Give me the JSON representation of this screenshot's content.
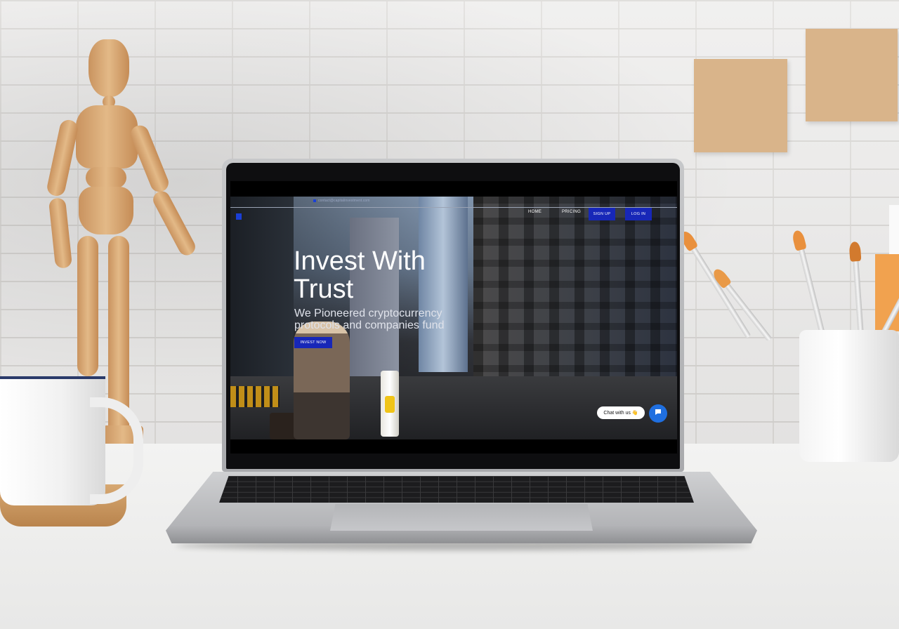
{
  "website": {
    "contact_email": "contact@capitalinvestment.com",
    "nav": {
      "home": "HOME",
      "pricing": "PRICING"
    },
    "buttons": {
      "signup": "SIGN UP",
      "login": "LOG IN",
      "invest": "INVEST NOW"
    },
    "hero": {
      "title": "Invest With Trust",
      "subtitle": "We Pioneered cryptocurrency protocols and companies fund"
    },
    "chat": {
      "label": "Chat with us 👋",
      "icon": "chat-bubble-icon"
    }
  },
  "colors": {
    "brand_blue": "#1727b8",
    "chat_blue": "#1f6fe0",
    "hero_text": "#ffffff"
  }
}
